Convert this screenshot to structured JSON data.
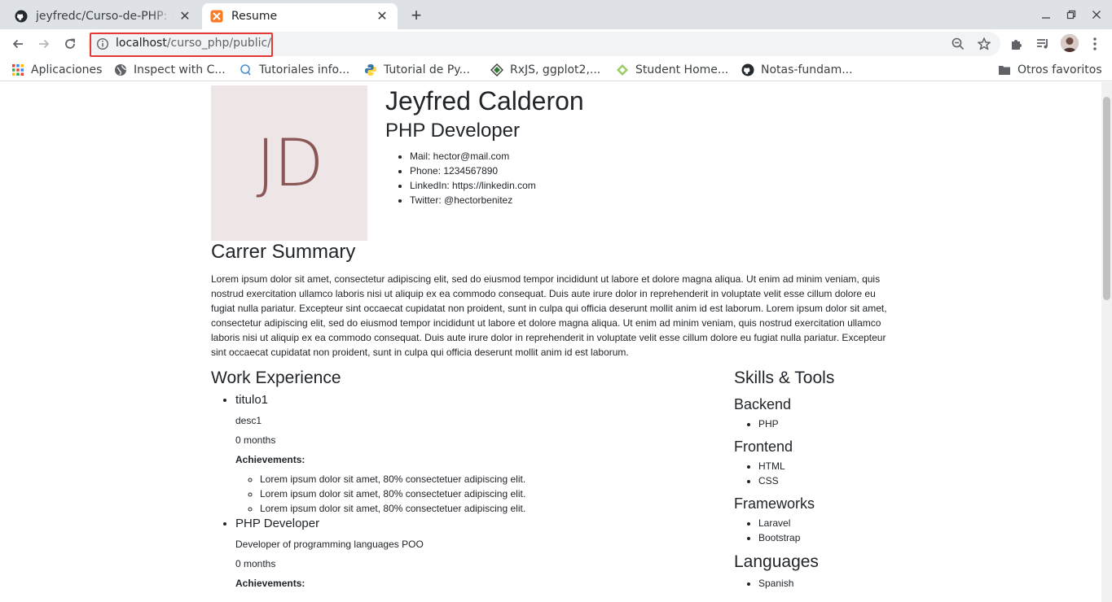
{
  "browser": {
    "tabs": [
      {
        "title": "jeyfredc/Curso-de-PHP: Cu",
        "icon": "github-icon"
      },
      {
        "title": "Resume",
        "icon": "xampp-icon"
      }
    ],
    "url": {
      "host": "localhost",
      "path": "/curso_php/public/"
    },
    "bookmarks": [
      {
        "label": "Aplicaciones",
        "icon": "apps-grid-icon"
      },
      {
        "label": "Inspect with C...",
        "icon": "globe-icon"
      },
      {
        "label": "Tutoriales info...",
        "icon": "bubble-icon"
      },
      {
        "label": "Tutorial de Py...",
        "icon": "python-icon"
      },
      {
        "label": "RxJS, ggplot2,...",
        "icon": "diamond-icon"
      },
      {
        "label": "Student Home...",
        "icon": "leaf-icon"
      },
      {
        "label": "Notas-fundam...",
        "icon": "github-icon"
      }
    ],
    "other_bookmarks": "Otros favoritos"
  },
  "resume": {
    "initials": "JD",
    "name": "Jeyfred Calderon",
    "role": "PHP Developer",
    "contact": [
      "Mail: hector@mail.com",
      "Phone: 1234567890",
      "LinkedIn: https://linkedin.com",
      "Twitter: @hectorbenitez"
    ],
    "summary_title": "Carrer Summary",
    "summary": "Lorem ipsum dolor sit amet, consectetur adipiscing elit, sed do eiusmod tempor incididunt ut labore et dolore magna aliqua. Ut enim ad minim veniam, quis nostrud exercitation ullamco laboris nisi ut aliquip ex ea commodo consequat. Duis aute irure dolor in reprehenderit in voluptate velit esse cillum dolore eu fugiat nulla pariatur. Excepteur sint occaecat cupidatat non proident, sunt in culpa qui officia deserunt mollit anim id est laborum. Lorem ipsum dolor sit amet, consectetur adipiscing elit, sed do eiusmod tempor incididunt ut labore et dolore magna aliqua. Ut enim ad minim veniam, quis nostrud exercitation ullamco laboris nisi ut aliquip ex ea commodo consequat. Duis aute irure dolor in reprehenderit in voluptate velit esse cillum dolore eu fugiat nulla pariatur. Excepteur sint occaecat cupidatat non proident, sunt in culpa qui officia deserunt mollit anim id est laborum.",
    "work_title": "Work Experience",
    "jobs": [
      {
        "title": "titulo1",
        "description": "desc1",
        "duration": "0 months",
        "achievements_label": "Achievements:",
        "achievements": [
          "Lorem ipsum dolor sit amet, 80% consectetuer adipiscing elit.",
          "Lorem ipsum dolor sit amet, 80% consectetuer adipiscing elit.",
          "Lorem ipsum dolor sit amet, 80% consectetuer adipiscing elit."
        ]
      },
      {
        "title": "PHP Developer",
        "description": "Developer of programming languages POO",
        "duration": "0 months",
        "achievements_label": "Achievements:"
      }
    ],
    "skills_title": "Skills & Tools",
    "skills": [
      {
        "category": "Backend",
        "items": [
          "PHP"
        ]
      },
      {
        "category": "Frontend",
        "items": [
          "HTML",
          "CSS"
        ]
      },
      {
        "category": "Frameworks",
        "items": [
          "Laravel",
          "Bootstrap"
        ]
      },
      {
        "category": "Languages",
        "items": [
          "Spanish"
        ]
      }
    ]
  }
}
